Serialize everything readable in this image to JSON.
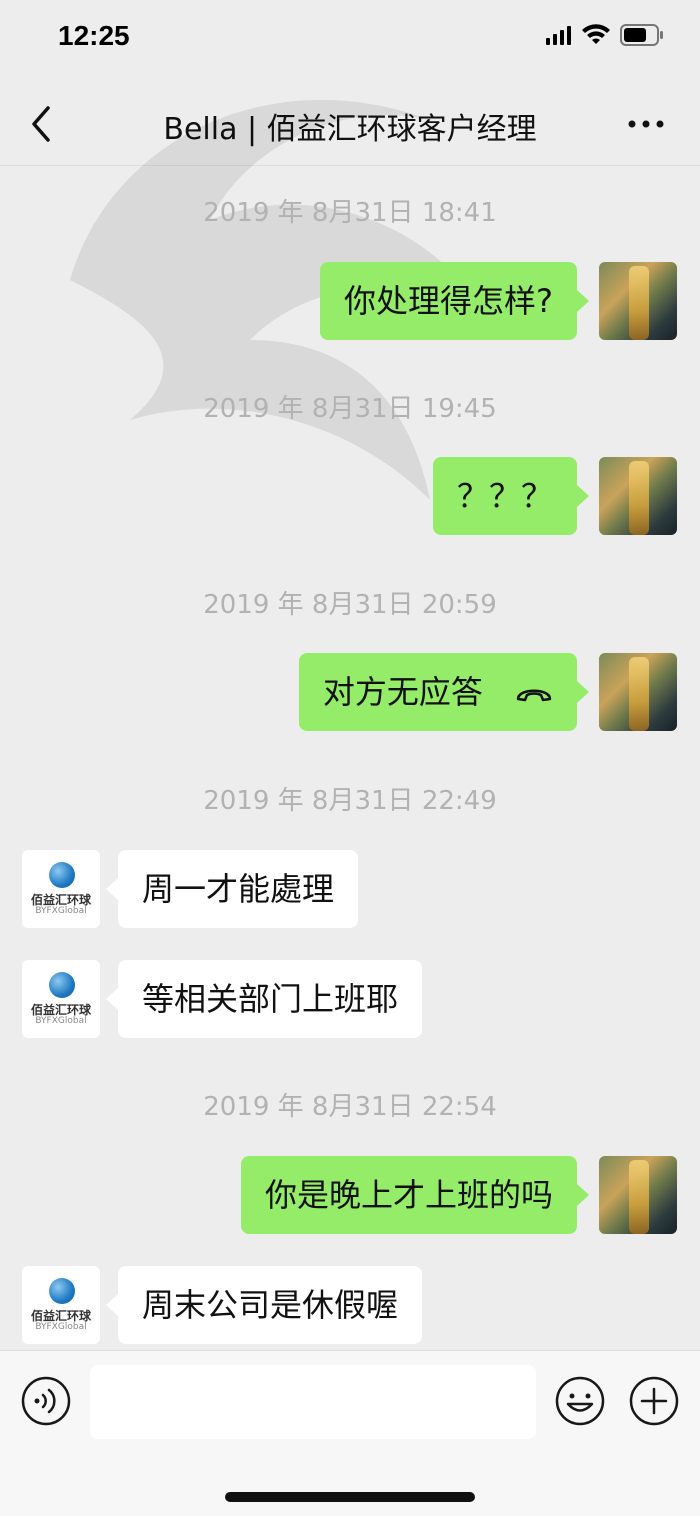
{
  "status_bar": {
    "time": "12:25"
  },
  "nav": {
    "title": "Bella | 佰益汇环球客户经理"
  },
  "brand": {
    "logo_text": "佰益汇环球",
    "logo_sub": "BYFXGlobal"
  },
  "messages": [
    {
      "type": "timestamp",
      "text": "2019 年 8月31日 18:41"
    },
    {
      "type": "self",
      "text": "你处理得怎样?"
    },
    {
      "type": "timestamp",
      "text": "2019 年 8月31日 19:45"
    },
    {
      "type": "self",
      "text": "？？？"
    },
    {
      "type": "timestamp",
      "text": "2019 年 8月31日 20:59"
    },
    {
      "type": "self",
      "text": "对方无应答",
      "icon": "phone-hangup-icon"
    },
    {
      "type": "timestamp",
      "text": "2019 年 8月31日 22:49"
    },
    {
      "type": "other",
      "text": "周一才能處理"
    },
    {
      "type": "other",
      "text": "等相关部门上班耶"
    },
    {
      "type": "timestamp",
      "text": "2019 年 8月31日 22:54"
    },
    {
      "type": "self",
      "text": "你是晚上才上班的吗"
    },
    {
      "type": "other",
      "text": "周末公司是休假喔"
    }
  ],
  "input": {
    "value": ""
  },
  "colors": {
    "self_bubble": "#95ec69",
    "other_bubble": "#ffffff",
    "background": "#ededed",
    "timestamp": "#b2b2b2"
  }
}
